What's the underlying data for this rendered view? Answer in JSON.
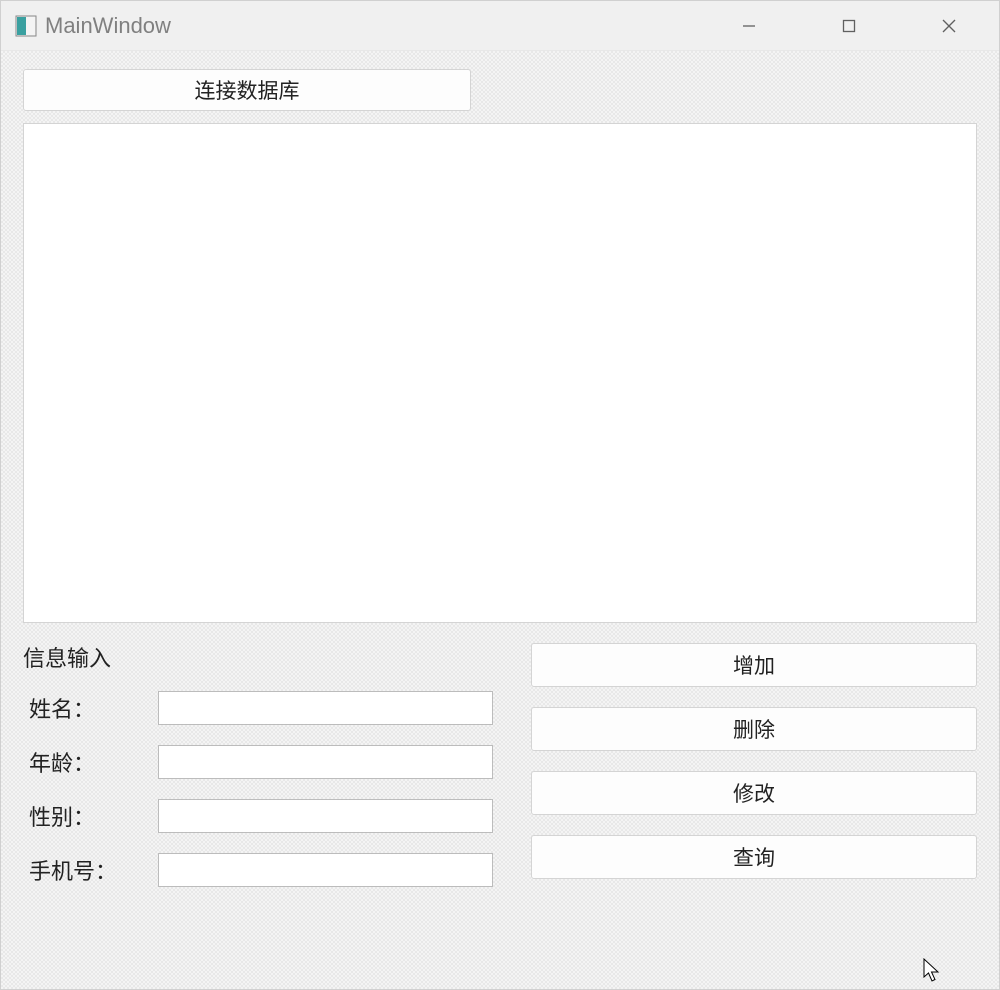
{
  "window": {
    "title": "MainWindow"
  },
  "toolbar": {
    "connect_label": "连接数据库"
  },
  "form": {
    "title": "信息输入",
    "fields": {
      "name": {
        "label": "姓名：",
        "value": ""
      },
      "age": {
        "label": "年龄：",
        "value": ""
      },
      "gender": {
        "label": "性别：",
        "value": ""
      },
      "phone": {
        "label": "手机号：",
        "value": ""
      }
    }
  },
  "actions": {
    "add": "增加",
    "delete": "删除",
    "update": "修改",
    "query": "查询"
  }
}
